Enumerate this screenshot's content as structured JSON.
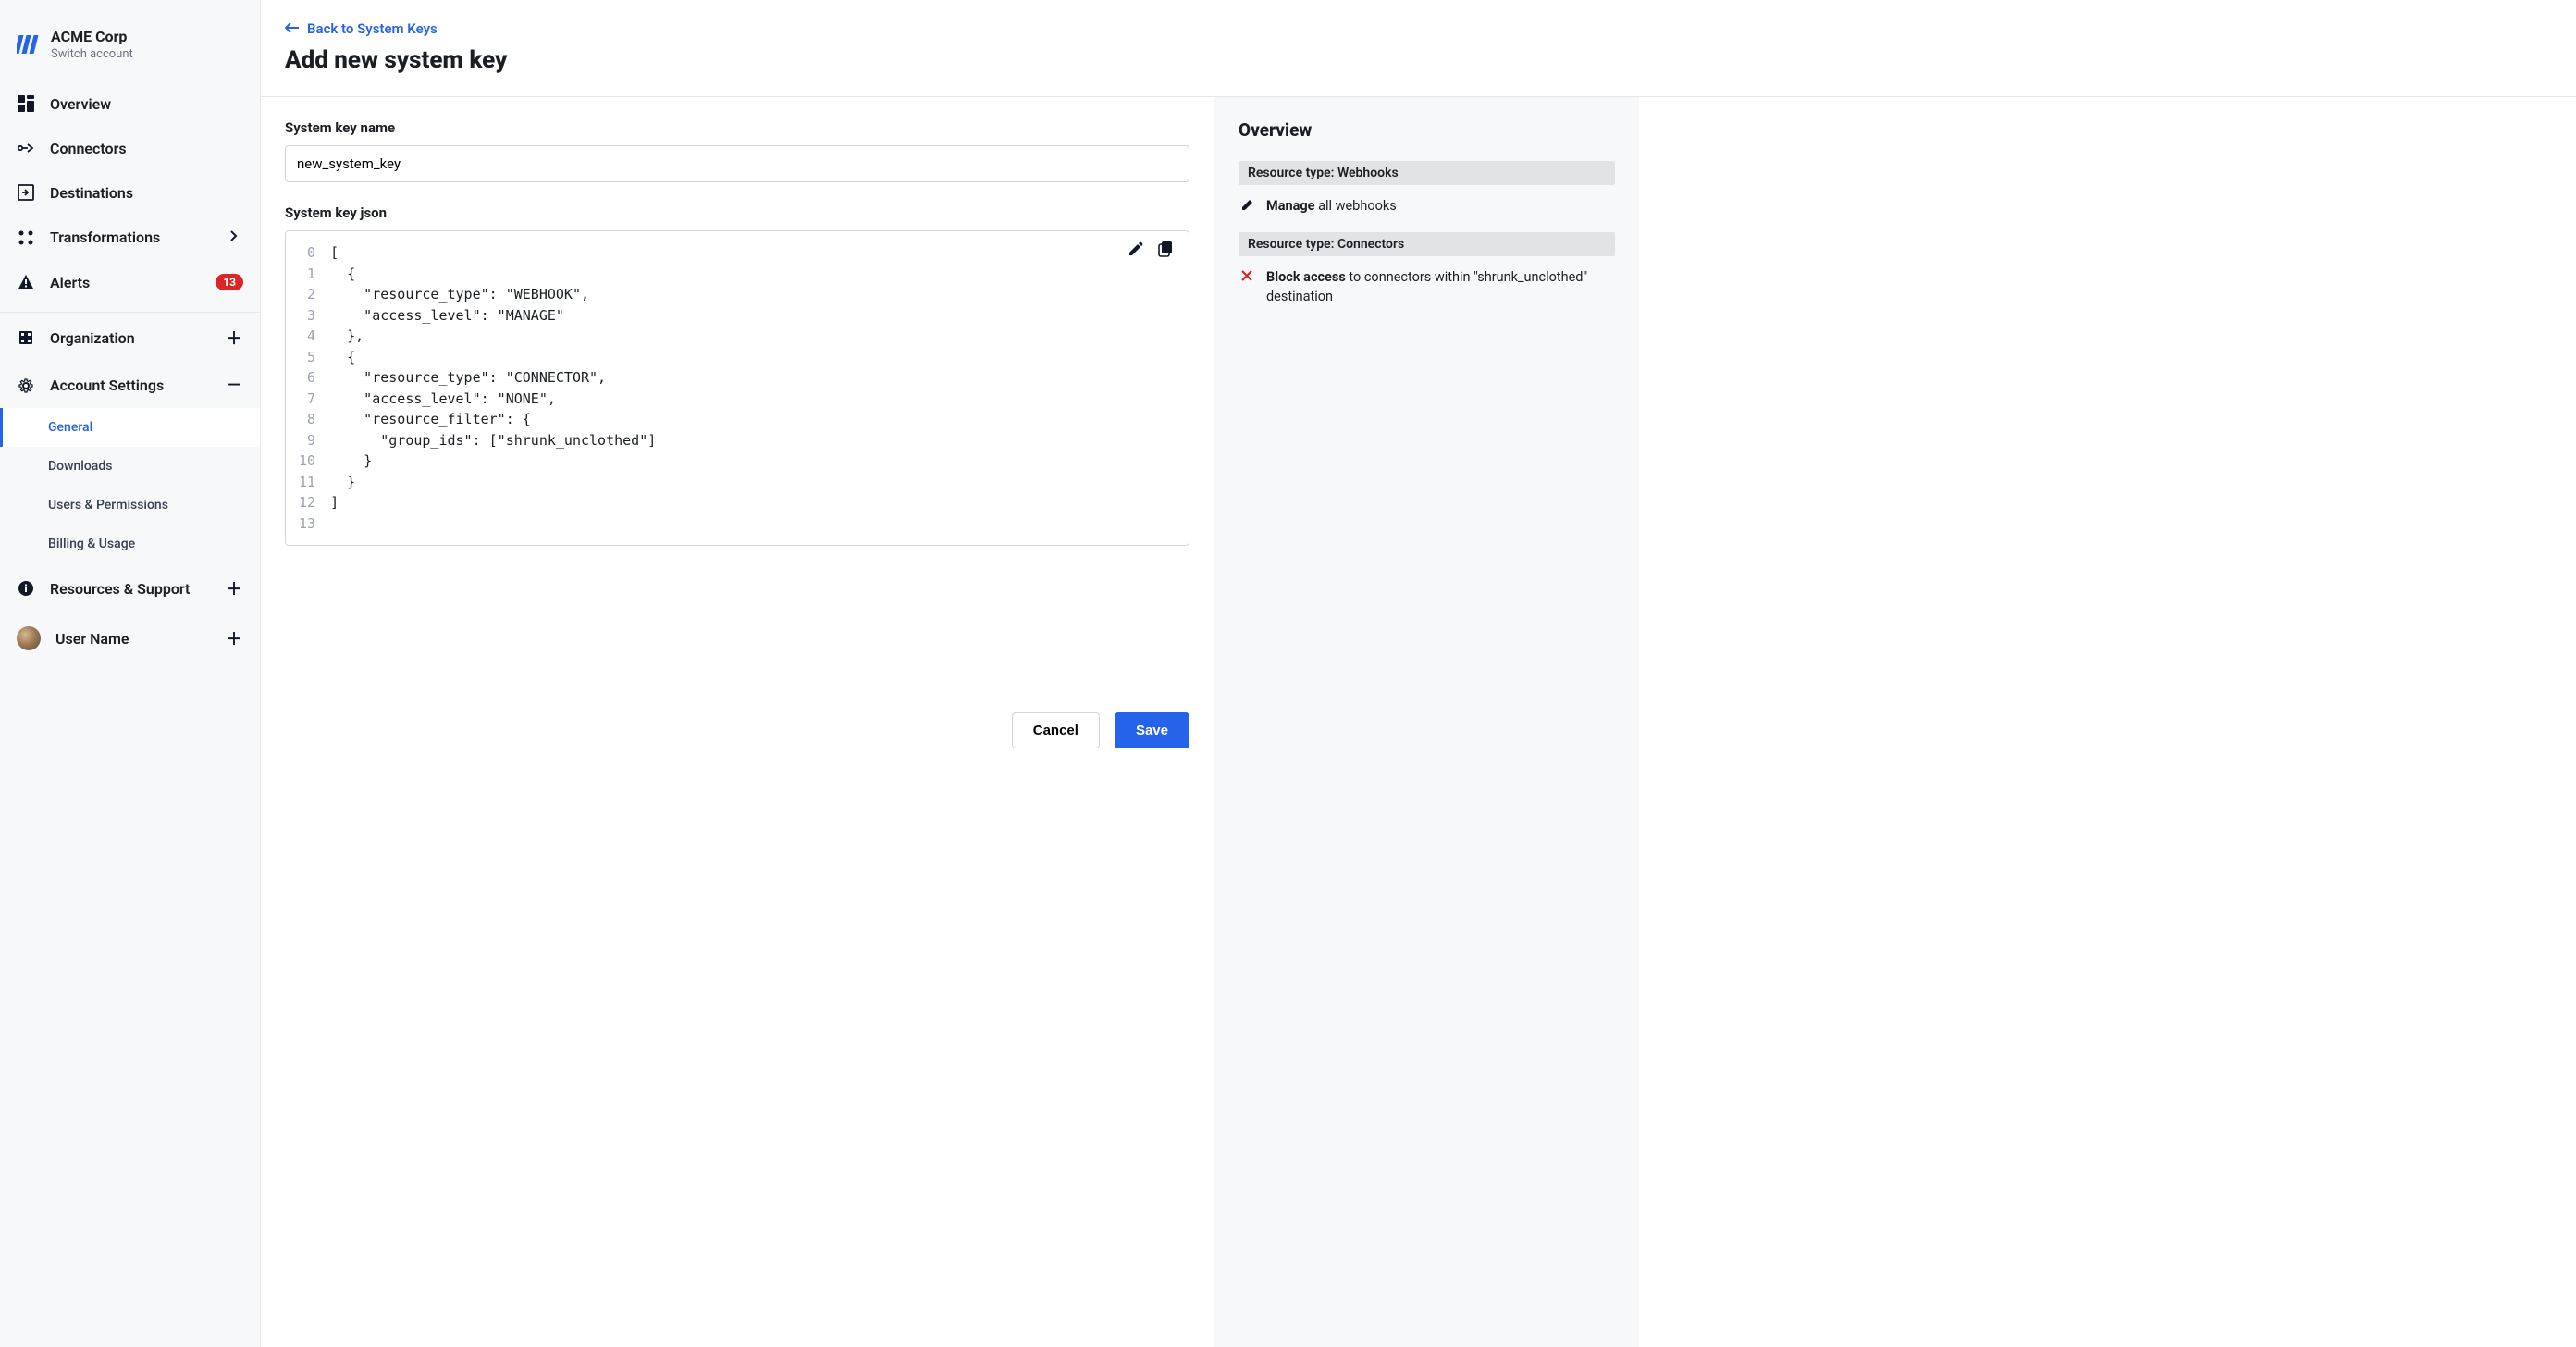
{
  "brand": {
    "name": "ACME Corp",
    "sub": "Switch account"
  },
  "nav": {
    "overview": "Overview",
    "connectors": "Connectors",
    "destinations": "Destinations",
    "transformations": "Transformations",
    "alerts": "Alerts",
    "alerts_badge": "13",
    "organization": "Organization",
    "account_settings": "Account Settings",
    "general": "General",
    "downloads": "Downloads",
    "users_permissions": "Users & Permissions",
    "billing_usage": "Billing & Usage",
    "resources_support": "Resources & Support",
    "user_name": "User Name"
  },
  "back_link": "Back to System Keys",
  "page_title": "Add new system key",
  "form": {
    "key_name_label": "System key name",
    "key_name_value": "new_system_key",
    "key_json_label": "System key json"
  },
  "code": {
    "l0": "[",
    "l1": "  {",
    "l2": "    \"resource_type\": \"WEBHOOK\",",
    "l3": "    \"access_level\": \"MANAGE\"",
    "l4": "  },",
    "l5": "  {",
    "l6": "    \"resource_type\": \"CONNECTOR\",",
    "l7": "    \"access_level\": \"NONE\",",
    "l8": "    \"resource_filter\": {",
    "l9": "      \"group_ids\": [\"shrunk_unclothed\"]",
    "l10": "    }",
    "l11": "  }",
    "l12": "]",
    "l13": ""
  },
  "buttons": {
    "cancel": "Cancel",
    "save": "Save"
  },
  "overview": {
    "title": "Overview",
    "res1_header": "Resource type: Webhooks",
    "res1_strong": "Manage",
    "res1_rest": " all webhooks",
    "res2_header": "Resource type: Connectors",
    "res2_strong": "Block access",
    "res2_rest": " to connectors within \"shrunk_unclothed\" destination"
  }
}
